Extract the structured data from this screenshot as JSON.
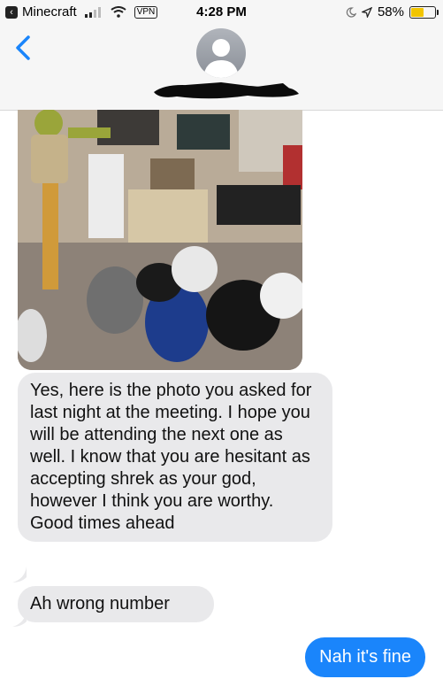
{
  "status_bar": {
    "back_app": "Minecraft",
    "vpn": "VPN",
    "time": "4:28 PM",
    "battery": "58%",
    "battery_level": 0.58,
    "signal_bars": 2,
    "battery_color": "#f2c500"
  },
  "header": {
    "back_icon": "chevron-left-icon",
    "avatar_icon": "person-silhouette-icon",
    "contact_name_redacted": true
  },
  "messages": [
    {
      "type": "image",
      "direction": "received",
      "alt_icon": "photo"
    },
    {
      "type": "text",
      "direction": "received",
      "text": "Yes, here is the photo you asked for last night at the meeting. I hope you will be attending the next one as well. I know that you are hesitant as accepting shrek as your god, however I think you are worthy. Good times ahead"
    },
    {
      "type": "text",
      "direction": "received",
      "text": "Ah wrong number"
    },
    {
      "type": "text",
      "direction": "sent",
      "text": "Nah it's fine"
    }
  ],
  "colors": {
    "sent_bubble": "#1a85fb",
    "received_bubble": "#e9e9eb",
    "accent": "#1a85fb"
  }
}
